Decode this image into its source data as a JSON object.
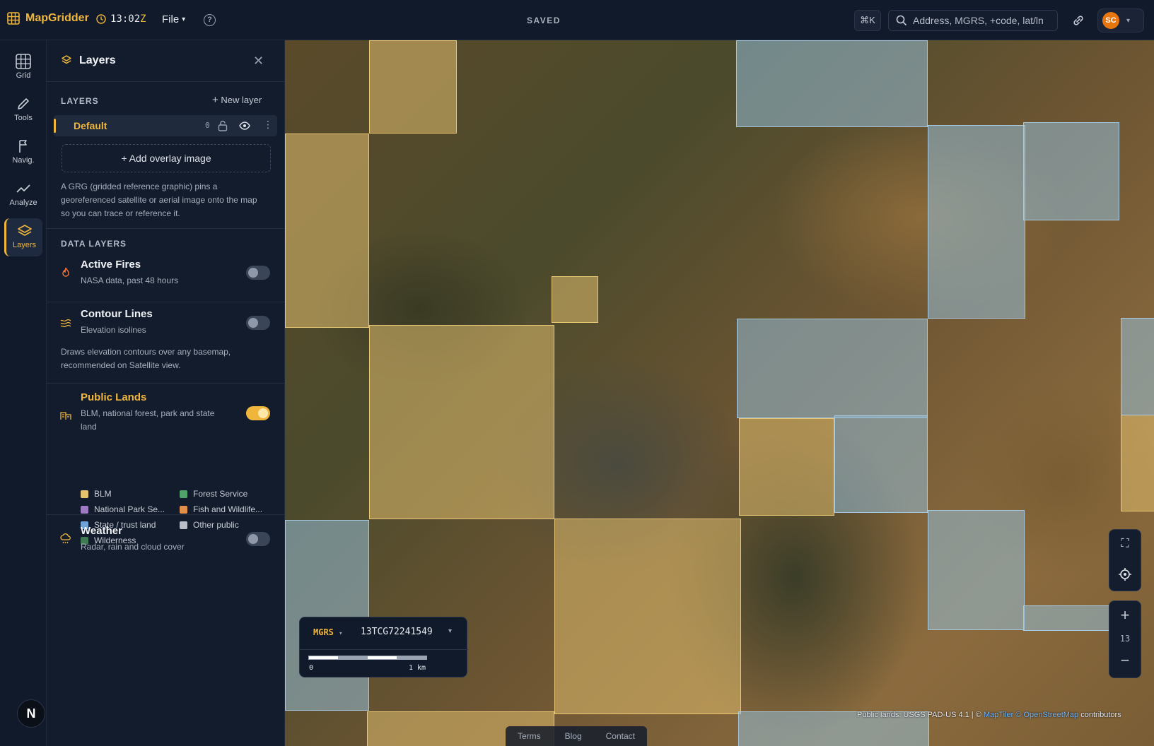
{
  "app": {
    "name": "MapGridder",
    "time": "13:02",
    "time_zone": "Z",
    "file_menu": "File",
    "status": "SAVED"
  },
  "header": {
    "shortcut": "⌘K",
    "search_placeholder": "Address, MGRS, +code, lat/ln",
    "user_initials": "SC"
  },
  "rail": {
    "grid": "Grid",
    "tools": "Tools",
    "navig": "Navig.",
    "analyze": "Analyze",
    "layers": "Layers",
    "logo": "N"
  },
  "panel": {
    "title": "Layers",
    "layers_heading": "LAYERS",
    "new_layer": "New layer",
    "default_layer": {
      "name": "Default",
      "count": "0"
    },
    "add_overlay": "+ Add overlay image",
    "help": "A GRG (gridded reference graphic) pins a georeferenced satellite or aerial image onto the map so you can trace or reference it.",
    "data_layers_heading": "DATA LAYERS",
    "data_layers": [
      {
        "title": "Active Fires",
        "subtitle": "NASA data, past 48 hours",
        "enabled": false
      },
      {
        "title": "Contour Lines",
        "subtitle": "Elevation isolines",
        "note": "Draws elevation contours over any basemap, recommended on Satellite view.",
        "enabled": false
      },
      {
        "title": "Public Lands",
        "subtitle": "BLM, national forest, park and state land",
        "enabled": true
      },
      {
        "title": "Weather",
        "subtitle": "Radar, rain and cloud cover",
        "enabled": false
      }
    ],
    "legend": [
      {
        "label": "BLM",
        "color": "#e6c16f"
      },
      {
        "label": "Forest Service",
        "color": "#4fa36b"
      },
      {
        "label": "National Park Se...",
        "color": "#9c7bc2"
      },
      {
        "label": "Fish and Wildlife...",
        "color": "#e0904a"
      },
      {
        "label": "State / trust land",
        "color": "#6fa3d8"
      },
      {
        "label": "Other public",
        "color": "#b9bec8"
      },
      {
        "label": "Wilderness",
        "color": "#3f7a55"
      }
    ]
  },
  "map": {
    "coord_format": "MGRS",
    "coord_value": "13TCG72241549",
    "scale_start": "0",
    "scale_end": "1 km",
    "zoom_level": "13",
    "attribution_prefix": "Public lands: USGS PAD-US 4.1 | ©",
    "attribution_maptiler": "MapTiler",
    "attribution_osm": "© OpenStreetMap",
    "attribution_suffix": "contributors"
  },
  "footer": {
    "terms": "Terms",
    "blog": "Blog",
    "contact": "Contact"
  },
  "colors": {
    "accent": "#f0b63c",
    "blm": "#e6c16f",
    "state": "#96bed7"
  }
}
